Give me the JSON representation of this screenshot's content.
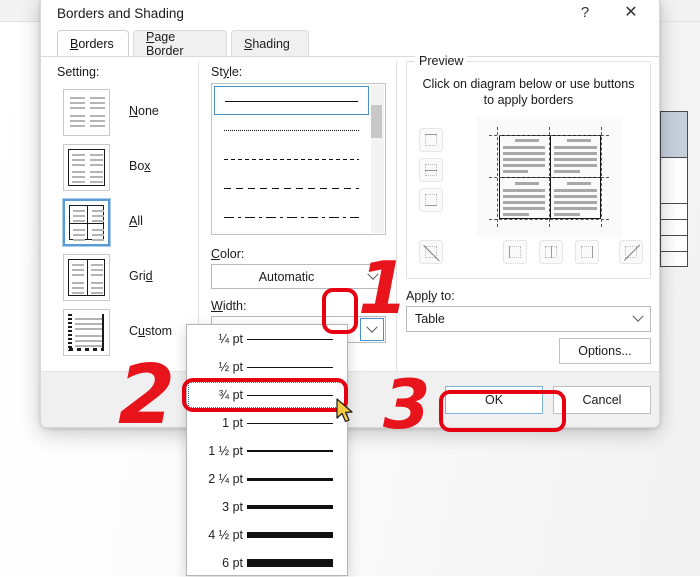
{
  "dialog": {
    "title": "Borders and Shading",
    "help_icon": "?",
    "close_icon": "✕",
    "tabs": [
      {
        "label": "Borders",
        "accel": "B",
        "active": true
      },
      {
        "label": "Page Border",
        "accel": "P",
        "active": false
      },
      {
        "label": "Shading",
        "accel": "S",
        "active": false
      }
    ]
  },
  "setting": {
    "label": "Setting:",
    "items": [
      {
        "label": "None",
        "accel": "N",
        "selected": false
      },
      {
        "label": "Box",
        "accel": "B",
        "selected": false
      },
      {
        "label": "All",
        "accel": "A",
        "selected": true
      },
      {
        "label": "Grid",
        "accel": "G",
        "selected": false
      },
      {
        "label": "Custom",
        "accel": "u",
        "selected": false
      }
    ]
  },
  "style": {
    "label": "Style:",
    "items": [
      {
        "name": "solid",
        "selected": true
      },
      {
        "name": "dotted",
        "selected": false
      },
      {
        "name": "dashed-small",
        "selected": false
      },
      {
        "name": "dashed-medium",
        "selected": false
      },
      {
        "name": "dash-dot",
        "selected": false
      }
    ]
  },
  "color": {
    "label": "Color:",
    "accel": "C",
    "value": "Automatic"
  },
  "width": {
    "label": "Width:",
    "accel": "W",
    "value": "¾ pt",
    "dropdown_open": true,
    "options": [
      {
        "label": "¼ pt",
        "thickness": 1.0,
        "selected": false
      },
      {
        "label": "½ pt",
        "thickness": 1.2,
        "selected": false
      },
      {
        "label": "¾ pt",
        "thickness": 1.4,
        "selected": true
      },
      {
        "label": "1 pt",
        "thickness": 1.7,
        "selected": false
      },
      {
        "label": "1 ½ pt",
        "thickness": 2.4,
        "selected": false
      },
      {
        "label": "2 ¼ pt",
        "thickness": 3.4,
        "selected": false
      },
      {
        "label": "3 pt",
        "thickness": 4.6,
        "selected": false
      },
      {
        "label": "4 ½ pt",
        "thickness": 6.2,
        "selected": false
      },
      {
        "label": "6 pt",
        "thickness": 8.0,
        "selected": false
      }
    ]
  },
  "preview": {
    "label": "Preview",
    "hint_line1": "Click on diagram below or use buttons",
    "hint_line2": "to apply borders",
    "side_buttons": [
      "border-top-button",
      "border-horizontal-inside-button",
      "border-bottom-button"
    ],
    "bottom_buttons": [
      "diagonal-down-button",
      "border-left-button",
      "border-vertical-inside-button",
      "border-right-button",
      "diagonal-up-button"
    ]
  },
  "apply_to": {
    "label": "Apply to:",
    "accel": "l",
    "value": "Table"
  },
  "buttons": {
    "options": "Options...",
    "ok": "OK",
    "cancel": "Cancel"
  },
  "annotations": [
    {
      "number": "1",
      "target": "width-dropdown-arrow"
    },
    {
      "number": "2",
      "target": "width-option-three-quarter-pt"
    },
    {
      "number": "3",
      "target": "ok-button"
    }
  ],
  "colors": {
    "annotation_red": "#e8141c",
    "accent_blue": "#4a90c4",
    "dialog_bg": "#ffffff",
    "footer_bg": "#f0f0f0"
  }
}
